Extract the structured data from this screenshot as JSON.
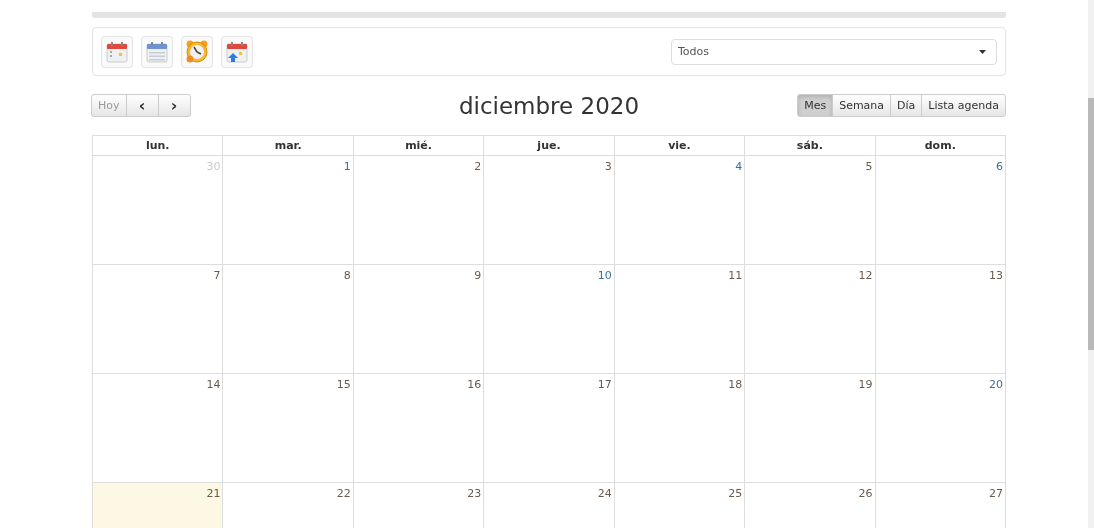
{
  "toolbar": {
    "icons": [
      {
        "kind": "calendar"
      },
      {
        "kind": "list"
      },
      {
        "kind": "alarm"
      },
      {
        "kind": "upload"
      }
    ],
    "filter": {
      "value": "Todos"
    }
  },
  "nav": {
    "today": "Hoy",
    "today_disabled": true,
    "prev": "‹",
    "next": "›"
  },
  "title": "diciembre 2020",
  "views": [
    {
      "label": "Mes",
      "selected": true
    },
    {
      "label": "Semana",
      "selected": false
    },
    {
      "label": "Día",
      "selected": false
    },
    {
      "label": "Lista agenda",
      "selected": false
    }
  ],
  "weekdays": [
    "lun.",
    "mar.",
    "mié.",
    "jue.",
    "vie.",
    "sáb.",
    "dom."
  ],
  "weeks": [
    [
      {
        "day": "30",
        "other_month": true,
        "today": false,
        "color": "#bbbbbb"
      },
      {
        "day": "1",
        "other_month": false,
        "today": false,
        "color": "#3b6ea0"
      },
      {
        "day": "2",
        "other_month": false,
        "today": false,
        "color": "#6b5a4a"
      },
      {
        "day": "3",
        "other_month": false,
        "today": false,
        "color": "#6b5a4a"
      },
      {
        "day": "4",
        "other_month": false,
        "today": false,
        "color": "#3b6ea0"
      },
      {
        "day": "5",
        "other_month": false,
        "today": false,
        "color": "#6b5a4a"
      },
      {
        "day": "6",
        "other_month": false,
        "today": false,
        "color": "#3b6ea0"
      }
    ],
    [
      {
        "day": "7",
        "other_month": false,
        "today": false,
        "color": "#6b5a4a"
      },
      {
        "day": "8",
        "other_month": false,
        "today": false,
        "color": "#6b5a4a"
      },
      {
        "day": "9",
        "other_month": false,
        "today": false,
        "color": "#6b5a4a"
      },
      {
        "day": "10",
        "other_month": false,
        "today": false,
        "color": "#3b6ea0"
      },
      {
        "day": "11",
        "other_month": false,
        "today": false,
        "color": "#6b5a4a"
      },
      {
        "day": "12",
        "other_month": false,
        "today": false,
        "color": "#6b5a4a"
      },
      {
        "day": "13",
        "other_month": false,
        "today": false,
        "color": "#6b5a4a"
      }
    ],
    [
      {
        "day": "14",
        "other_month": false,
        "today": false,
        "color": "#6b5a4a"
      },
      {
        "day": "15",
        "other_month": false,
        "today": false,
        "color": "#6b5a4a"
      },
      {
        "day": "16",
        "other_month": false,
        "today": false,
        "color": "#6b5a4a"
      },
      {
        "day": "17",
        "other_month": false,
        "today": false,
        "color": "#6b5a4a"
      },
      {
        "day": "18",
        "other_month": false,
        "today": false,
        "color": "#6b5a4a"
      },
      {
        "day": "19",
        "other_month": false,
        "today": false,
        "color": "#6b5a4a"
      },
      {
        "day": "20",
        "other_month": false,
        "today": false,
        "color": "#3b6ea0"
      }
    ],
    [
      {
        "day": "21",
        "other_month": false,
        "today": true,
        "color": "#6b5a4a"
      },
      {
        "day": "22",
        "other_month": false,
        "today": false,
        "color": "#6b5a4a"
      },
      {
        "day": "23",
        "other_month": false,
        "today": false,
        "color": "#6b5a4a"
      },
      {
        "day": "24",
        "other_month": false,
        "today": false,
        "color": "#6b5a4a"
      },
      {
        "day": "25",
        "other_month": false,
        "today": false,
        "color": "#6b5a4a"
      },
      {
        "day": "26",
        "other_month": false,
        "today": false,
        "color": "#6b5a4a"
      },
      {
        "day": "27",
        "other_month": false,
        "today": false,
        "color": "#6b5a4a"
      }
    ]
  ]
}
